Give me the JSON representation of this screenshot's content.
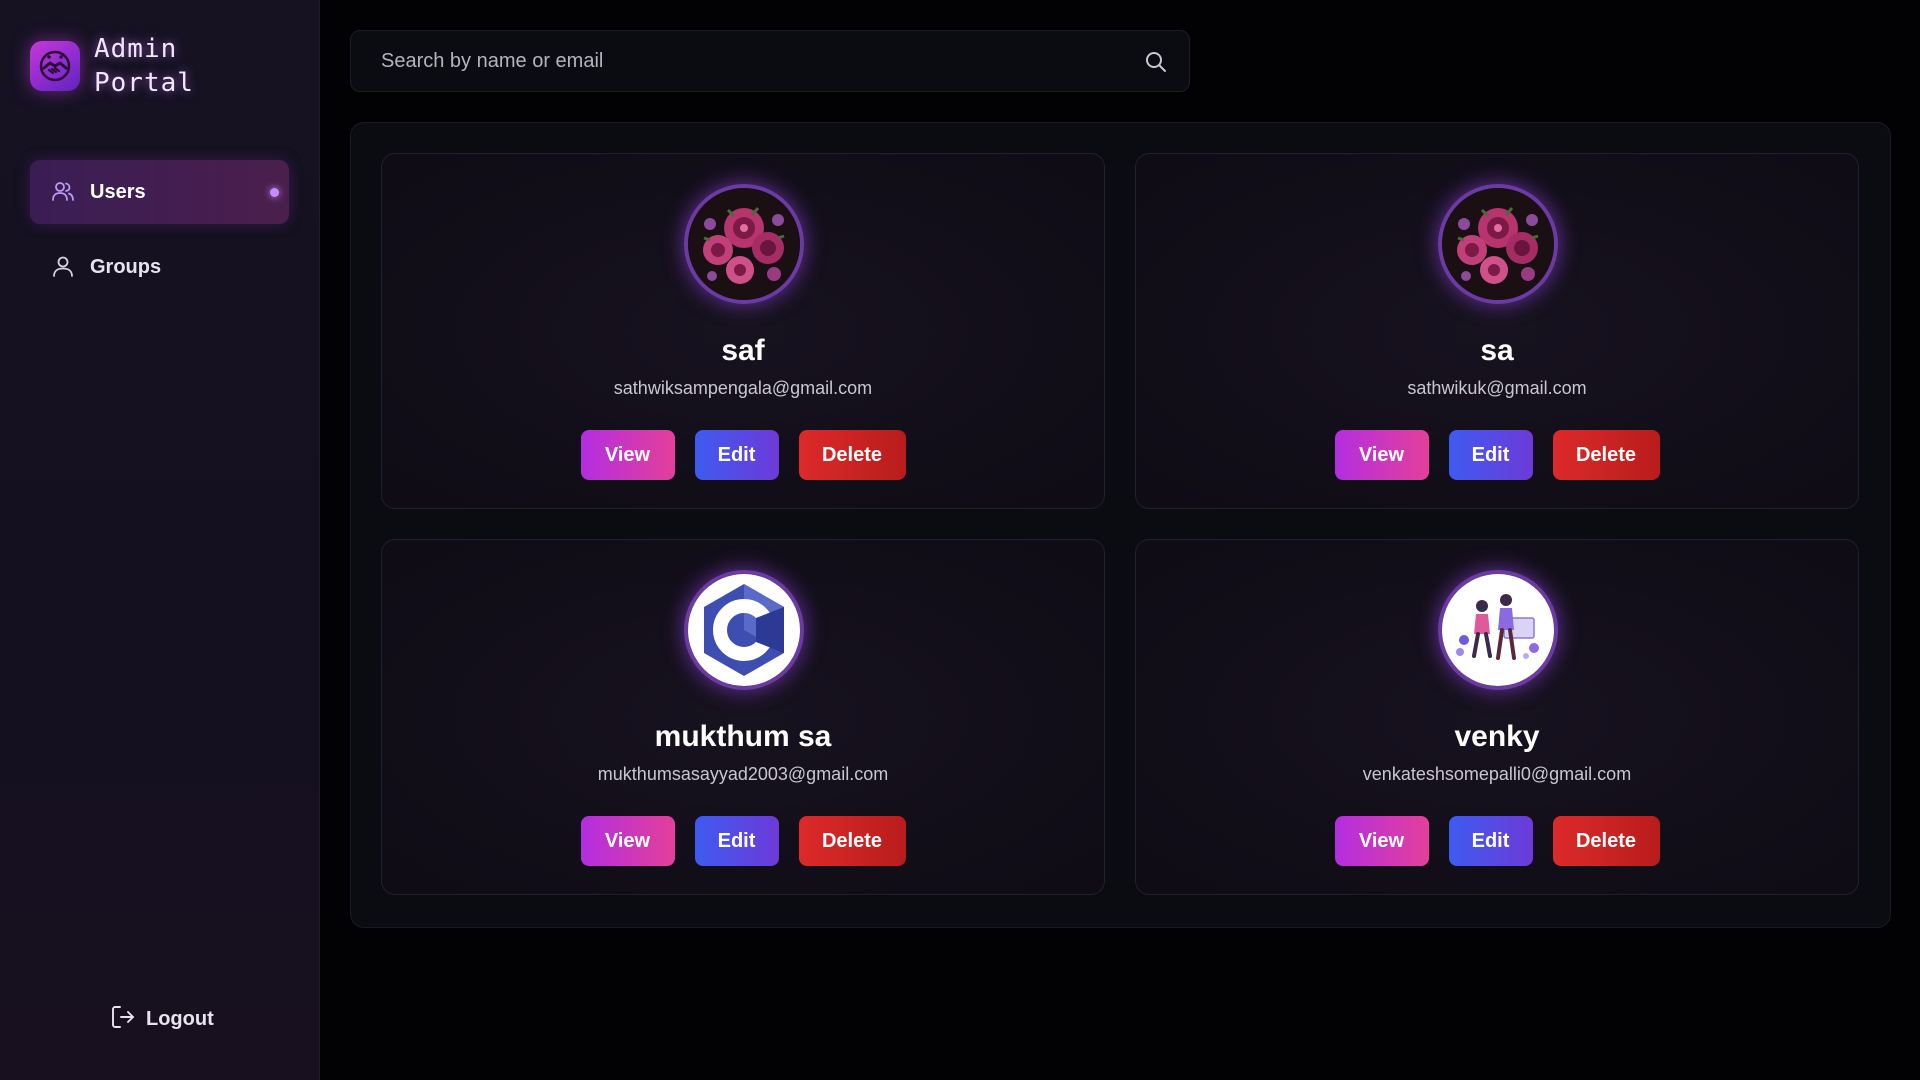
{
  "brand": {
    "title_line1": "Admin",
    "title_line2": "Portal",
    "logo_icon": "handshake-icon"
  },
  "sidebar": {
    "items": [
      {
        "label": "Users",
        "icon": "users-icon",
        "active": true
      },
      {
        "label": "Groups",
        "icon": "user-icon",
        "active": false
      }
    ],
    "logout_label": "Logout"
  },
  "search": {
    "placeholder": "Search by name or email",
    "value": ""
  },
  "buttons": {
    "view": "View",
    "edit": "Edit",
    "delete": "Delete"
  },
  "users": [
    {
      "name": "saf",
      "email": "sathwiksampengala@gmail.com",
      "avatar": "rose-bouquet-avatar"
    },
    {
      "name": "sa",
      "email": "sathwikuk@gmail.com",
      "avatar": "rose-bouquet-avatar"
    },
    {
      "name": "mukthum sa",
      "email": "mukthumsasayyad2003@gmail.com",
      "avatar": "c-language-logo-avatar"
    },
    {
      "name": "venky",
      "email": "venkateshsomepalli0@gmail.com",
      "avatar": "people-illustration-avatar"
    }
  ],
  "colors": {
    "accent": "#c78bff",
    "view_button": "#b32ee0",
    "edit_button": "#3e5bf0",
    "delete_button": "#dc2a2a",
    "background": "#020204",
    "sidebar": "#161222"
  }
}
